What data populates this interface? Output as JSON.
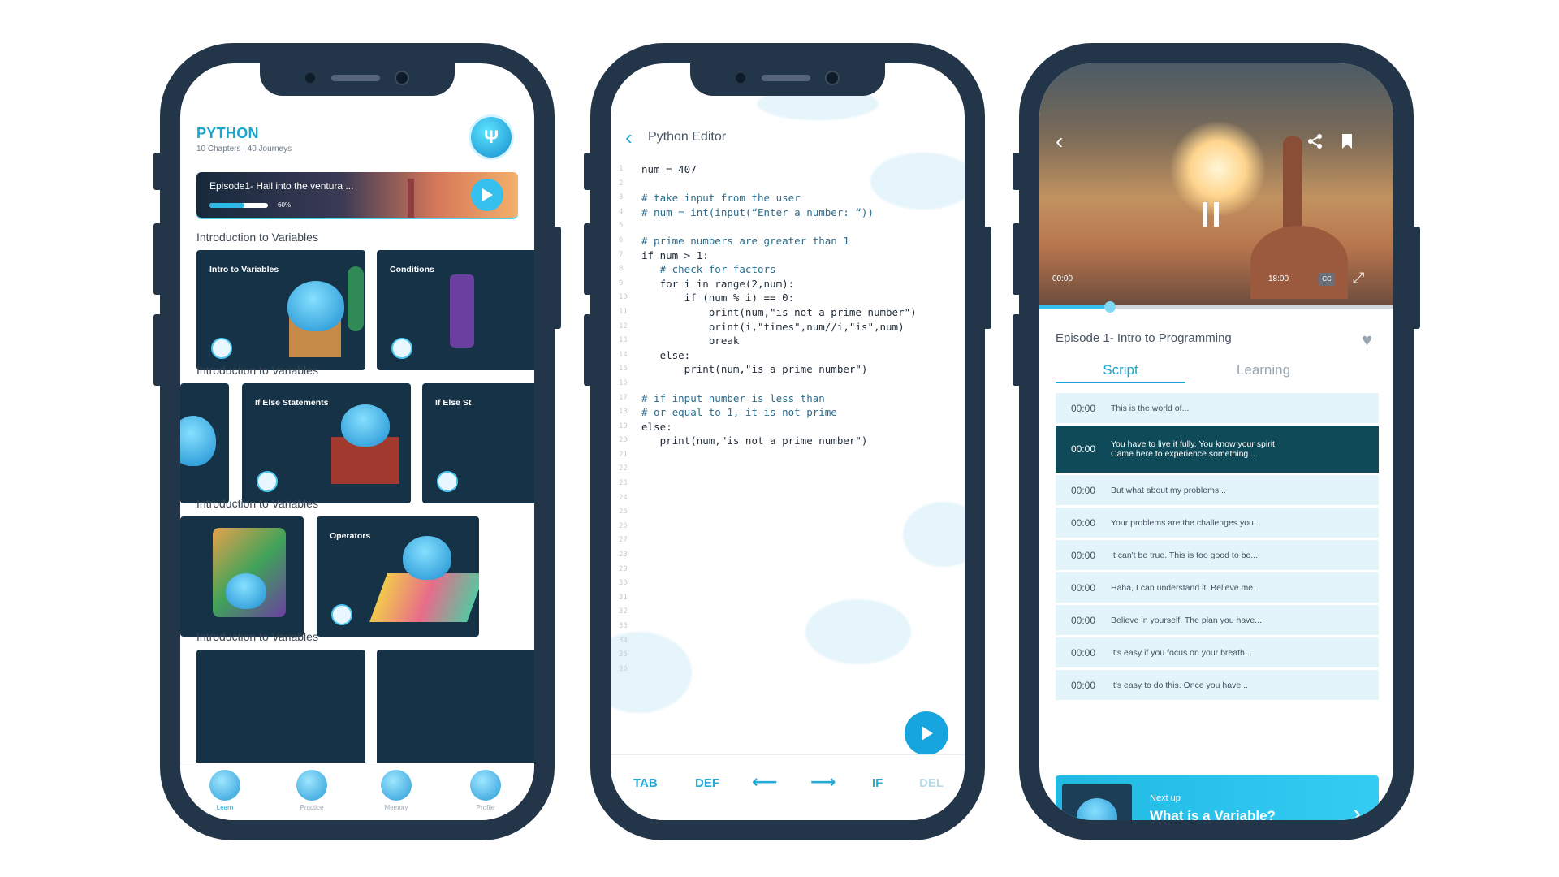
{
  "phone1": {
    "title": "PYTHON",
    "subtitle": "10 Chapters | 40 Journeys",
    "badge_icon": "trident-icon",
    "hero": {
      "title": "Episode1- Hail into the ventura ...",
      "progress_label": "60%",
      "progress": 0.6
    },
    "sections": [
      {
        "label": "Introduction to Variables",
        "cards": [
          "Intro to Variables",
          "Conditions"
        ]
      },
      {
        "label": "Introduction to Variables",
        "cards": [
          "",
          "If Else Statements",
          "If Else St"
        ]
      },
      {
        "label": "Introduction to Variables",
        "cards": [
          "",
          "Operators"
        ]
      },
      {
        "label": "Introduction to Variables",
        "cards": []
      }
    ],
    "tabs": [
      {
        "label": "Learn",
        "icon": "learn-mascot-icon",
        "active": true
      },
      {
        "label": "Practice",
        "icon": "practice-mascot-icon",
        "active": false
      },
      {
        "label": "Memory",
        "icon": "memory-mascot-icon",
        "active": false
      },
      {
        "label": "Profile",
        "icon": "profile-mascot-icon",
        "active": false
      }
    ]
  },
  "phone2": {
    "header": "Python Editor",
    "back_icon": "chevron-left-icon",
    "code_lines": [
      "num = 407",
      "",
      "# take input from the user",
      "# num = int(input(“Enter a number: “))",
      "",
      "# prime numbers are greater than 1",
      "if num > 1:",
      "   # check for factors",
      "   for i in range(2,num):",
      "       if (num % i) == 0:",
      "           print(num,\"is not a prime number\")",
      "           print(i,\"times\",num//i,\"is\",num)",
      "           break",
      "   else:",
      "       print(num,\"is a prime number\")",
      "",
      "# if input number is less than",
      "# or equal to 1, it is not prime",
      "else:",
      "   print(num,\"is not a prime number\")"
    ],
    "line_numbers": [
      "1",
      "2",
      "3",
      "4",
      "5",
      "6",
      "7",
      "8",
      "9",
      "10",
      "11",
      "12",
      "13",
      "14",
      "15",
      "16",
      "17",
      "18",
      "19",
      "20",
      "21",
      "22",
      "23",
      "24",
      "25",
      "26",
      "27",
      "28",
      "29",
      "30",
      "31",
      "32",
      "33",
      "34",
      "35",
      "36"
    ],
    "keys": [
      "TAB",
      "DEF",
      "⟵",
      "⟶",
      "IF",
      "DEL"
    ],
    "run_icon": "play-icon"
  },
  "phone3": {
    "time_start": "00:00",
    "time_end": "18:00",
    "cc": "CC",
    "progress": 0.2,
    "episode_title": "Episode 1- Intro to Programming",
    "tabs": [
      "Script",
      "Learning"
    ],
    "script": [
      {
        "time": "00:00",
        "text": "This is the world of...",
        "active": false
      },
      {
        "time": "00:00",
        "text": "You have to live it fully. You know your spirit\nCame here to experience something...",
        "active": true
      },
      {
        "time": "00:00",
        "text": "But what about my problems...",
        "active": false
      },
      {
        "time": "00:00",
        "text": "Your problems are the challenges you...",
        "active": false
      },
      {
        "time": "00:00",
        "text": "It can't be true. This is too good to be...",
        "active": false
      },
      {
        "time": "00:00",
        "text": "Haha, I can understand it. Believe me...",
        "active": false
      },
      {
        "time": "00:00",
        "text": "Believe in yourself. The plan you have...",
        "active": false
      },
      {
        "time": "00:00",
        "text": "It's easy if you focus on your breath...",
        "active": false
      },
      {
        "time": "00:00",
        "text": "It's easy to do this. Once you have...",
        "active": false
      }
    ],
    "next_up_caption": "Next up",
    "next_up_title": "What is a Variable?"
  },
  "colors": {
    "frame": "#233548",
    "accent": "#16a6d0",
    "card_bg": "#163247"
  }
}
